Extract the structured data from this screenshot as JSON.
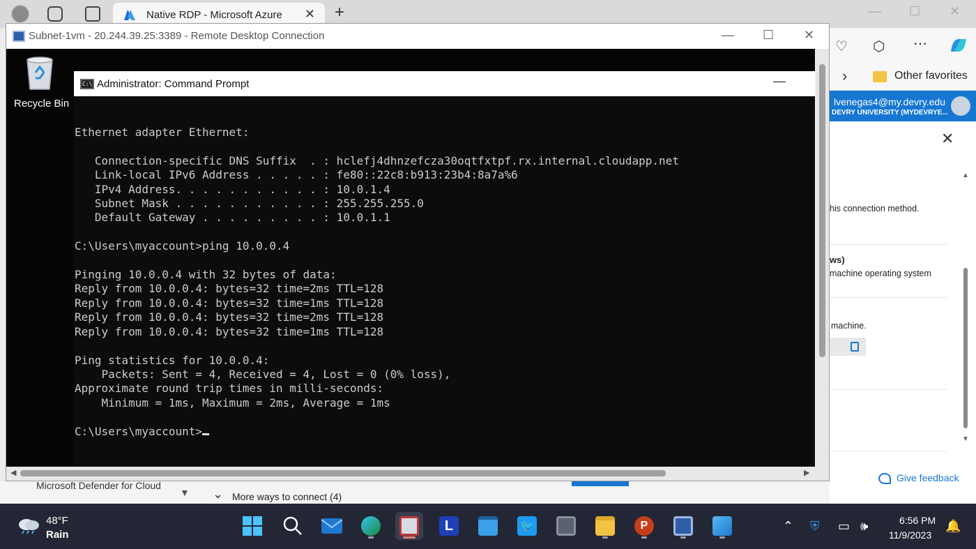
{
  "browser": {
    "tab_title": "Native RDP - Microsoft Azure",
    "favorites_label": "Other favorites",
    "account_email": "lvenegas4@my.devry.edu",
    "account_org": "DEVRY UNIVERSITY (MYDEVRYE..."
  },
  "azure_panel": {
    "text_1": "his connection method.",
    "text_2_heading": "ws)",
    "text_2_body": "machine operating system",
    "text_3": "machine.",
    "feedback": "Give feedback",
    "defender": "Microsoft Defender for Cloud",
    "more_ways": "More ways to connect (4)"
  },
  "rdp": {
    "title": "Subnet-1vm - 20.244.39.25:3389 - Remote Desktop Connection",
    "recycle_bin": "Recycle Bin"
  },
  "cmd": {
    "title": "Administrator: Command Prompt",
    "lines": [
      "Ethernet adapter Ethernet:",
      "",
      "   Connection-specific DNS Suffix  . : hclefj4dhnzefcza30oqtfxtpf.rx.internal.cloudapp.net",
      "   Link-local IPv6 Address . . . . . : fe80::22c8:b913:23b4:8a7a%6",
      "   IPv4 Address. . . . . . . . . . . : 10.0.1.4",
      "   Subnet Mask . . . . . . . . . . . : 255.255.255.0",
      "   Default Gateway . . . . . . . . . : 10.0.1.1",
      "",
      "C:\\Users\\myaccount>ping 10.0.0.4",
      "",
      "Pinging 10.0.0.4 with 32 bytes of data:",
      "Reply from 10.0.0.4: bytes=32 time=2ms TTL=128",
      "Reply from 10.0.0.4: bytes=32 time=1ms TTL=128",
      "Reply from 10.0.0.4: bytes=32 time=2ms TTL=128",
      "Reply from 10.0.0.4: bytes=32 time=1ms TTL=128",
      "",
      "Ping statistics for 10.0.0.4:",
      "    Packets: Sent = 4, Received = 4, Lost = 0 (0% loss),",
      "Approximate round trip times in milli-seconds:",
      "    Minimum = 1ms, Maximum = 2ms, Average = 1ms",
      ""
    ],
    "prompt": "C:\\Users\\myaccount>"
  },
  "taskbar": {
    "weather_temp": "48°F",
    "weather_cond": "Rain",
    "time": "6:56 PM",
    "date": "11/9/2023",
    "apps": [
      "start",
      "search",
      "mail",
      "edge",
      "remote-desktop",
      "l-app",
      "notepad",
      "twitter",
      "calculator",
      "file-explorer",
      "powerpoint",
      "rdp-connection",
      "paint"
    ]
  }
}
